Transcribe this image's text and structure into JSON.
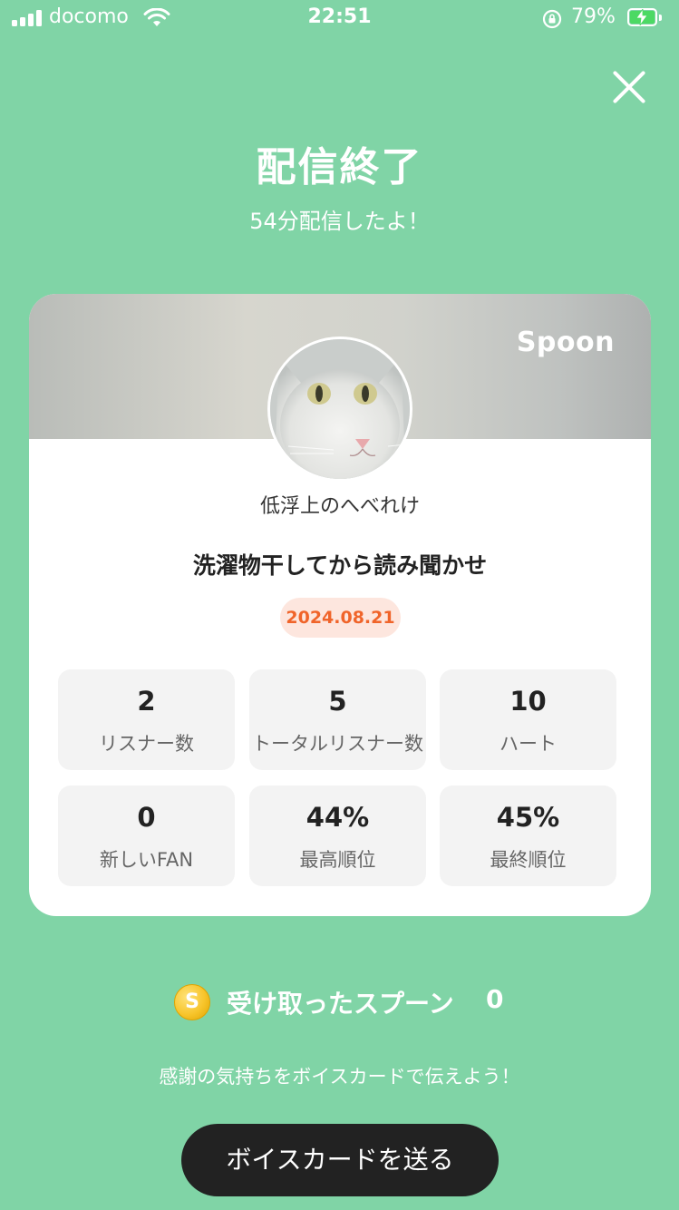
{
  "status_bar": {
    "carrier": "docomo",
    "time": "22:51",
    "battery_percent": "79%",
    "charging": true
  },
  "header": {
    "close_icon": "close-icon",
    "title": "配信終了",
    "subtitle": "54分配信したよ！"
  },
  "card": {
    "brand": "Spoon",
    "username": "低浮上のへべれけ",
    "stream_title": "洗濯物干してから読み聞かせ",
    "date": "2024.08.21",
    "stats": [
      {
        "value": "2",
        "label": "リスナー数"
      },
      {
        "value": "5",
        "label": "トータルリスナー数"
      },
      {
        "value": "10",
        "label": "ハート"
      },
      {
        "value": "0",
        "label": "新しいFAN"
      },
      {
        "value": "44%",
        "label": "最高順位"
      },
      {
        "value": "45%",
        "label": "最終順位"
      }
    ]
  },
  "spoons": {
    "icon": "coin-icon",
    "label": "受け取ったスプーン",
    "count": "0"
  },
  "footer": {
    "thanks_text": "感謝の気持ちをボイスカードで伝えよう！",
    "send_button": "ボイスカードを送る"
  },
  "colors": {
    "background": "#80d4a6",
    "date_text": "#f0642a",
    "date_bg": "#fde6de",
    "button_bg": "#222222"
  }
}
